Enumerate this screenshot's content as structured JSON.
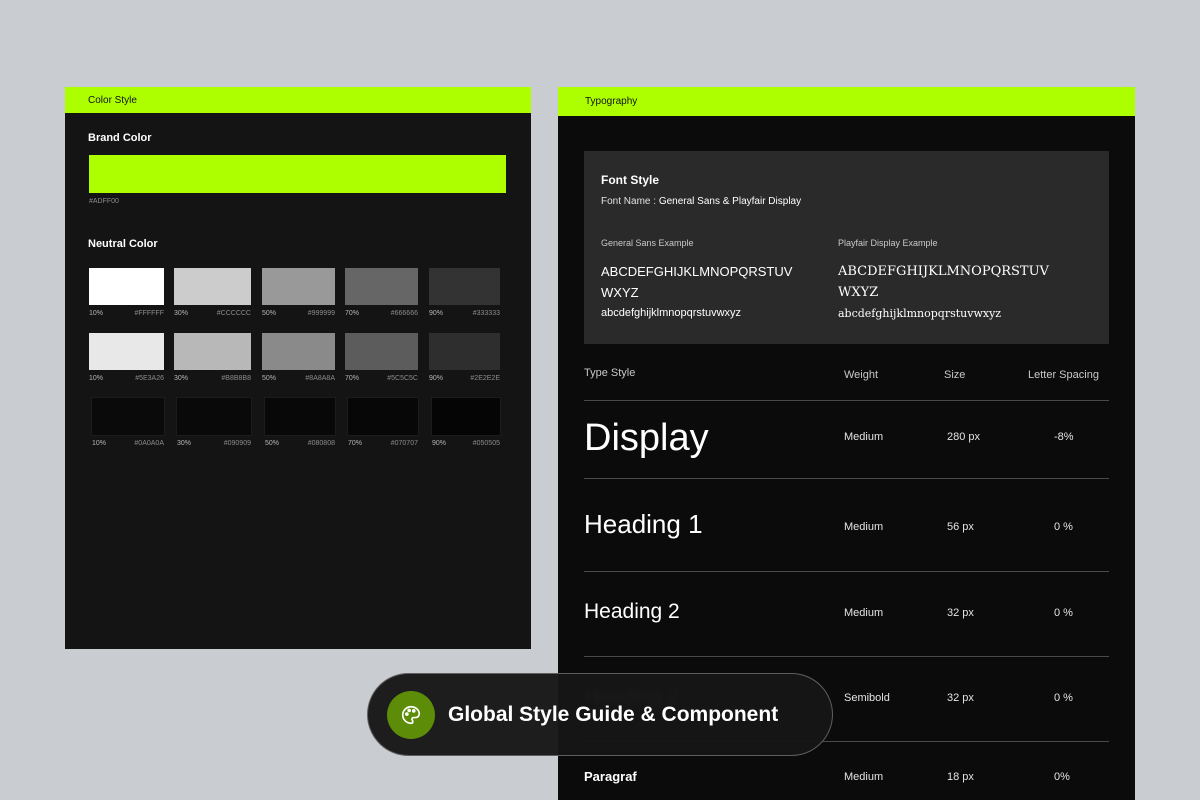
{
  "color_style": {
    "header": "Color Style",
    "brand_title": "Brand Color",
    "brand_hex": "#ADFF00",
    "brand_color": "#adff00",
    "neutral_title": "Neutral Color",
    "rows": [
      [
        {
          "label": "10%",
          "hex": "#FFFFFF",
          "color": "#ffffff"
        },
        {
          "label": "30%",
          "hex": "#CCCCCC",
          "color": "#cccccc"
        },
        {
          "label": "50%",
          "hex": "#999999",
          "color": "#999999"
        },
        {
          "label": "70%",
          "hex": "#666666",
          "color": "#666666"
        },
        {
          "label": "90%",
          "hex": "#333333",
          "color": "#333333"
        }
      ],
      [
        {
          "label": "10%",
          "hex": "#5E3A26",
          "color": "#e8e8e8"
        },
        {
          "label": "30%",
          "hex": "#B8B8B8",
          "color": "#b8b8b8"
        },
        {
          "label": "50%",
          "hex": "#8A8A8A",
          "color": "#8a8a8a"
        },
        {
          "label": "70%",
          "hex": "#5C5C5C",
          "color": "#5c5c5c"
        },
        {
          "label": "90%",
          "hex": "#2E2E2E",
          "color": "#2e2e2e"
        }
      ],
      [
        {
          "label": "10%",
          "hex": "#0A0A0A",
          "color": "#0a0a0a"
        },
        {
          "label": "30%",
          "hex": "#090909",
          "color": "#090909"
        },
        {
          "label": "50%",
          "hex": "#080808",
          "color": "#080808"
        },
        {
          "label": "70%",
          "hex": "#070707",
          "color": "#070707"
        },
        {
          "label": "90%",
          "hex": "#050505",
          "color": "#050505"
        }
      ]
    ]
  },
  "typography": {
    "header": "Typography",
    "font_card": {
      "title": "Font Style",
      "name_label": "Font Name : ",
      "name_value": "General Sans & Playfair Display",
      "sans_title": "General Sans Example",
      "serif_title": "Playfair Display Example",
      "upper": "ABCDEFGHIJKLMNOPQRSTUV WXYZ",
      "lower": "abcdefghijklmnopqrstuvwxyz"
    },
    "columns": {
      "style": "Type Style",
      "weight": "Weight",
      "size": "Size",
      "spacing": "Letter Spacing"
    },
    "rows": [
      {
        "name": "Display",
        "weight": "Medium",
        "size": "280 px",
        "spacing": "-8%"
      },
      {
        "name": "Heading 1",
        "weight": "Medium",
        "size": "56 px",
        "spacing": "0 %"
      },
      {
        "name": "Heading 2",
        "weight": "Medium",
        "size": "32 px",
        "spacing": "0 %"
      },
      {
        "name": "Heading 2",
        "weight": "Semibold",
        "size": "32 px",
        "spacing": "0 %"
      },
      {
        "name": "Paragraf",
        "weight": "Medium",
        "size": "18 px",
        "spacing": "0%"
      }
    ]
  },
  "badge": {
    "icon": "palette-icon",
    "text": "Global Style Guide & Component",
    "accent": "#5d8d08"
  }
}
